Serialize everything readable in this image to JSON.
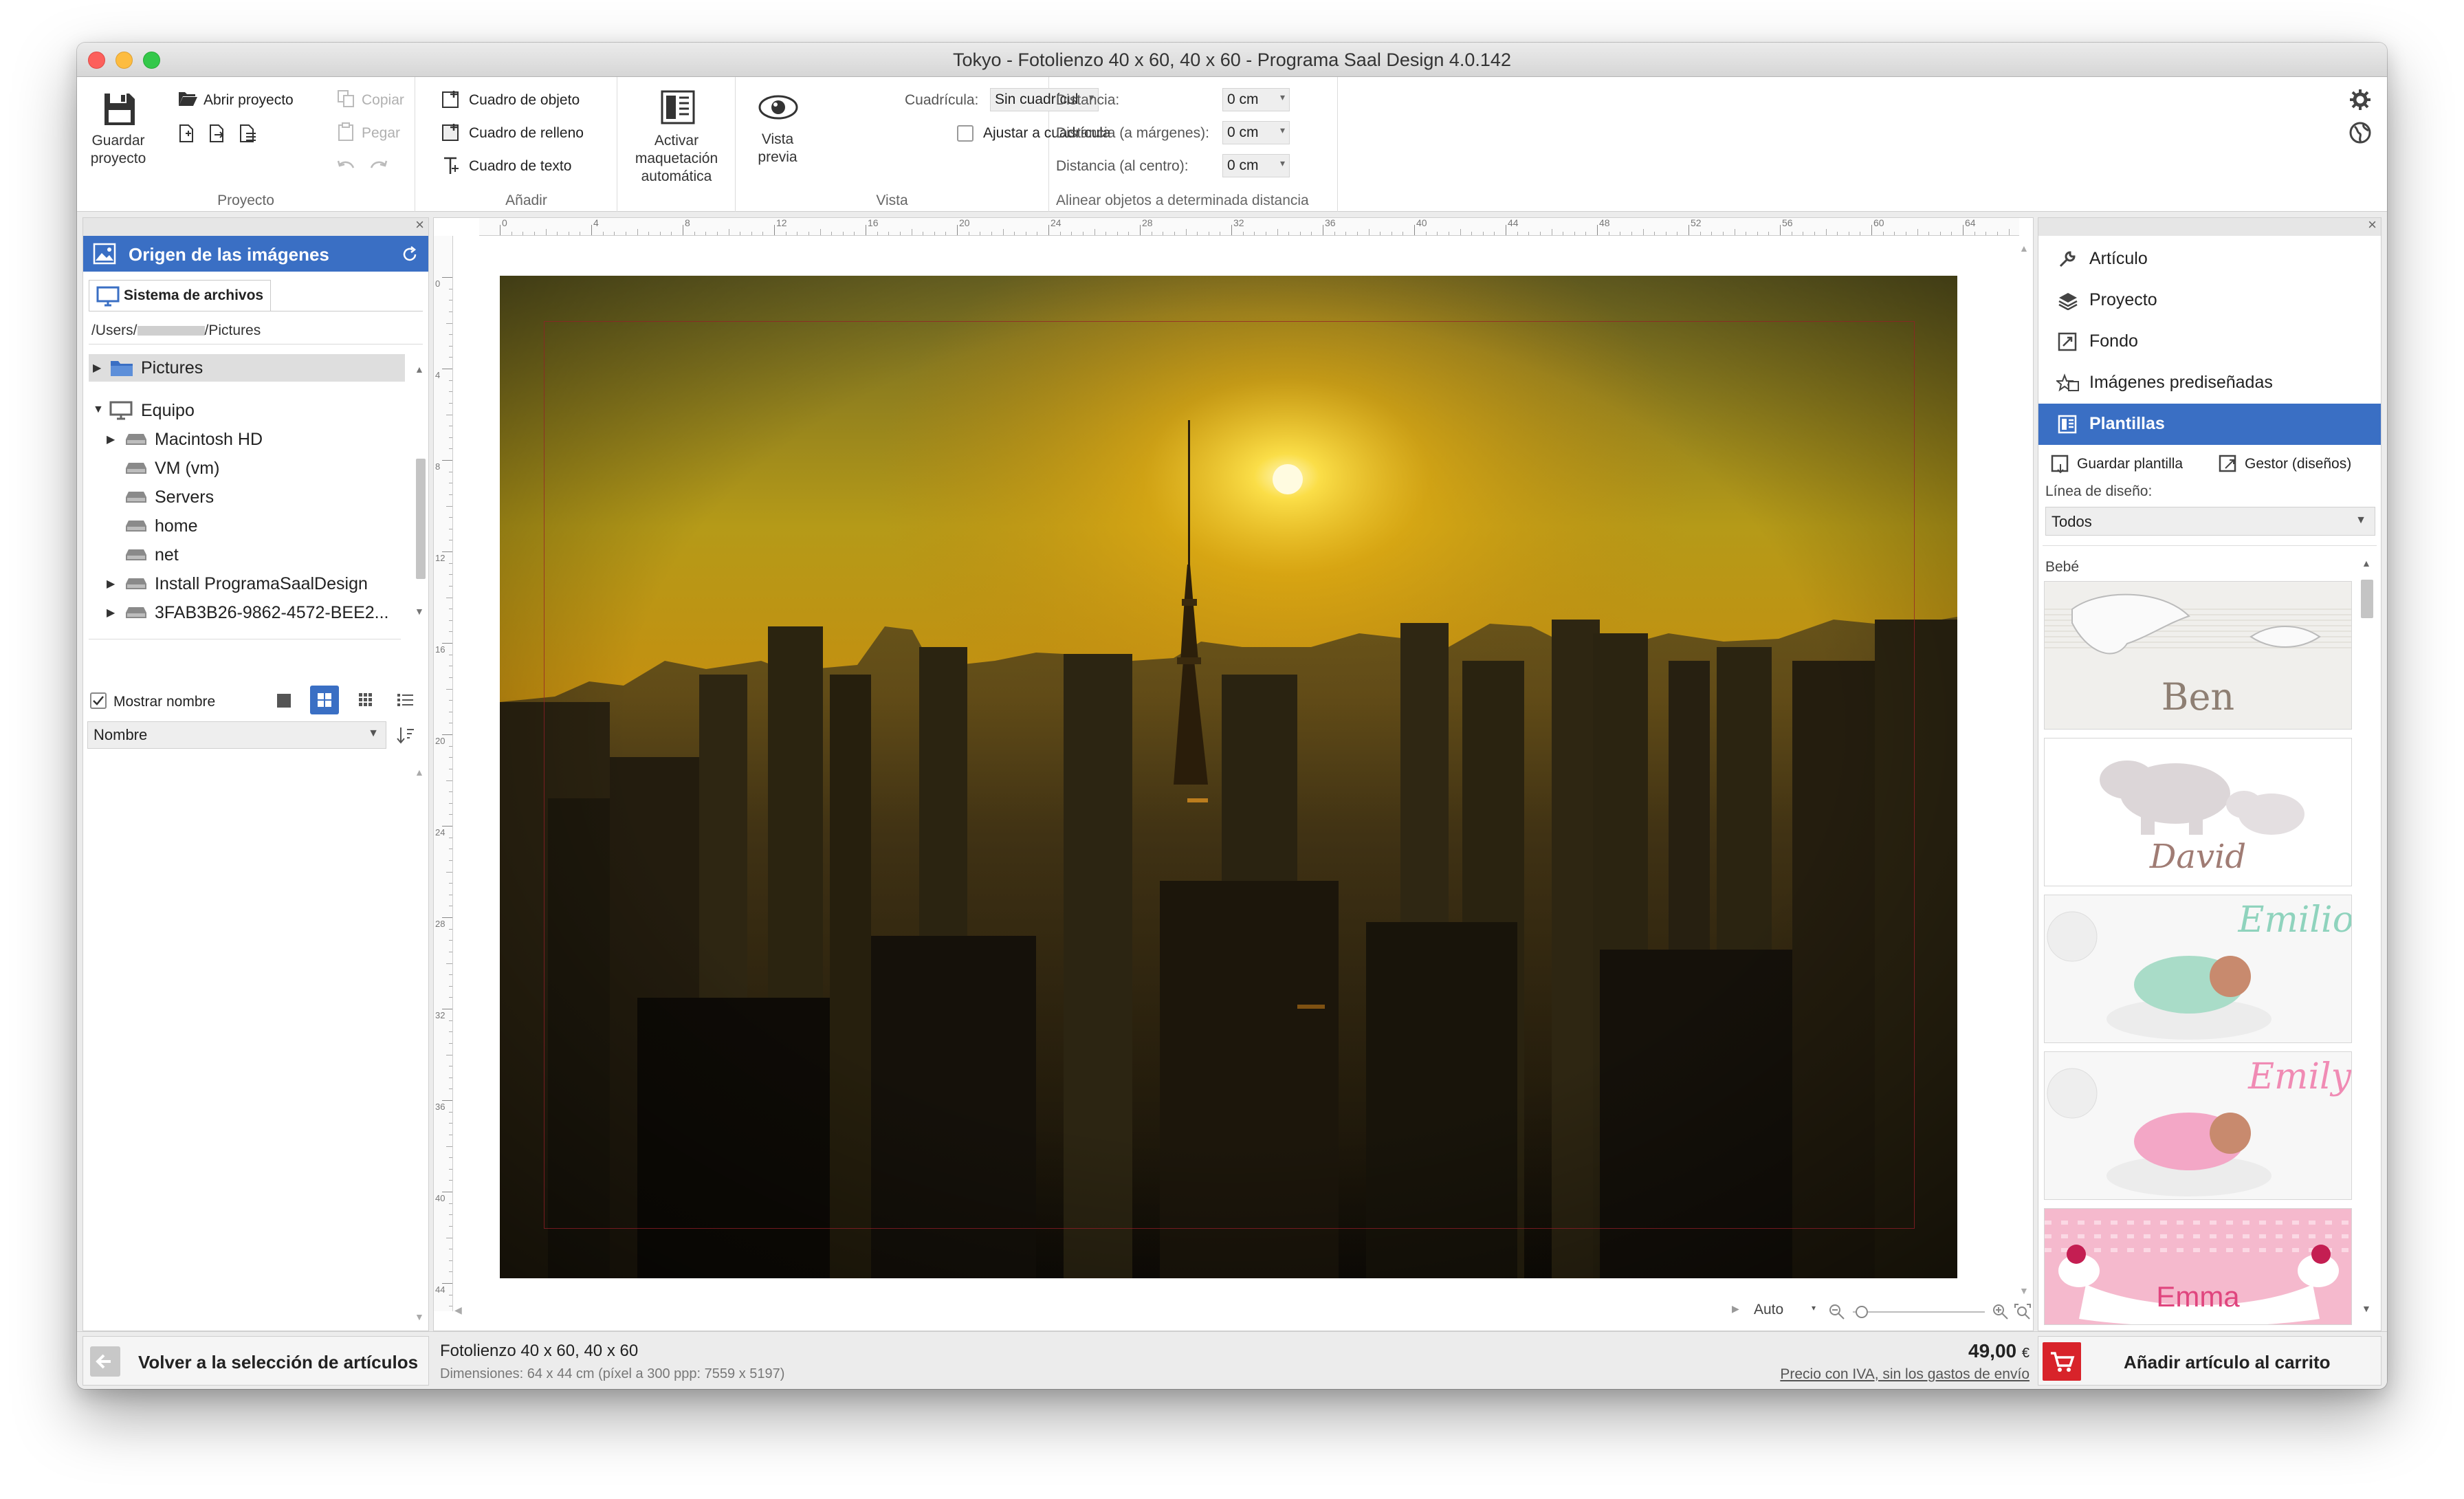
{
  "window": {
    "title": "Tokyo - Fotolienzo 40 x 60, 40 x 60 - Programa Saal Design 4.0.142"
  },
  "ribbon": {
    "proyecto": {
      "label": "Proyecto",
      "save_line1": "Guardar",
      "save_line2": "proyecto",
      "open": "Abrir proyecto",
      "copy": "Copiar",
      "paste": "Pegar"
    },
    "anadir": {
      "label": "Añadir",
      "object_box": "Cuadro de objeto",
      "fill_box": "Cuadro de relleno",
      "text_box": "Cuadro de texto"
    },
    "auto_layout": {
      "line1": "Activar",
      "line2": "maquetación",
      "line3": "automática"
    },
    "vista": {
      "label": "Vista",
      "preview_line1": "Vista",
      "preview_line2": "previa",
      "grid_label": "Cuadrícula:",
      "grid_value": "Sin cuadrícul",
      "snap_label": "Ajustar a cuadrícula"
    },
    "alinear": {
      "label": "Alinear objetos a determinada distancia",
      "distance_label": "Distancia:",
      "distance_value": "0 cm",
      "margin_label": "Distancia (a márgenes):",
      "margin_value": "0 cm",
      "center_label": "Distancia (al centro):",
      "center_value": "0 cm"
    }
  },
  "left_panel": {
    "header": "Origen de las imágenes",
    "tab": "Sistema de archivos",
    "path_prefix": "/Users/",
    "path_suffix": "/Pictures",
    "tree": [
      "Pictures",
      "Equipo",
      "Macintosh HD",
      "VM (vm)",
      "Servers",
      "home",
      "net",
      "Install ProgramaSaalDesign",
      "3FAB3B26-9862-4572-BEE2..."
    ],
    "show_name": "Mostrar nombre",
    "sort": "Nombre"
  },
  "canvas": {
    "ruler_h": [
      "0",
      "4",
      "8",
      "12",
      "16",
      "20",
      "24",
      "28",
      "32",
      "36",
      "40",
      "44",
      "48",
      "52",
      "56",
      "60",
      "64"
    ],
    "ruler_v": [
      "0",
      "4",
      "8",
      "12",
      "16",
      "20",
      "24",
      "28",
      "32",
      "36",
      "40",
      "44"
    ],
    "zoom": "Auto"
  },
  "right_panel": {
    "nav": [
      "Artículo",
      "Proyecto",
      "Fondo",
      "Imágenes prediseñadas",
      "Plantillas"
    ],
    "save_template": "Guardar plantilla",
    "manager": "Gestor (diseños)",
    "design_line_label": "Línea de diseño:",
    "design_line_value": "Todos",
    "category": "Bebé",
    "templates": [
      "Ben",
      "David",
      "Emilio",
      "Emily",
      "Emma"
    ]
  },
  "bottom": {
    "back": "Volver a la selección de artículos",
    "product": "Fotolienzo 40 x 60, 40 x 60",
    "dimensions": "Dimensiones: 64 x 44 cm (píxel a 300 ppp: 7559 x 5197)",
    "price": "49,00",
    "currency": "€",
    "price_note": "Precio con IVA, sin los gastos de envío",
    "add_cart": "Añadir artículo al carrito"
  },
  "colors": {
    "accent": "#3a6fc4",
    "cart": "#d8232a",
    "safe_margin": "#8c2028"
  }
}
